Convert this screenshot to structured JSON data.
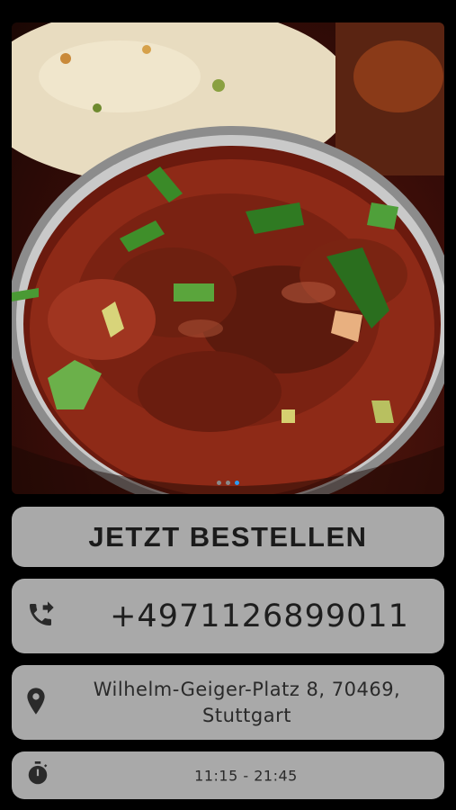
{
  "hero": {
    "image_description": "food-photo-curry",
    "slide_count": 3,
    "active_slide": 3
  },
  "order_button": {
    "label": "JETZT BESTELLEN"
  },
  "phone": {
    "icon": "phone-forwarded-icon",
    "number": "+4971126899011"
  },
  "address": {
    "icon": "location-pin-icon",
    "line1": "Wilhelm-Geiger-Platz 8, 70469,",
    "line2": "Stuttgart"
  },
  "hours": {
    "icon": "stopwatch-icon",
    "text": "11:15 - 21:45"
  },
  "colors": {
    "background": "#000000",
    "card": "#a9a9a9",
    "active_dot": "#2b9bf4"
  }
}
